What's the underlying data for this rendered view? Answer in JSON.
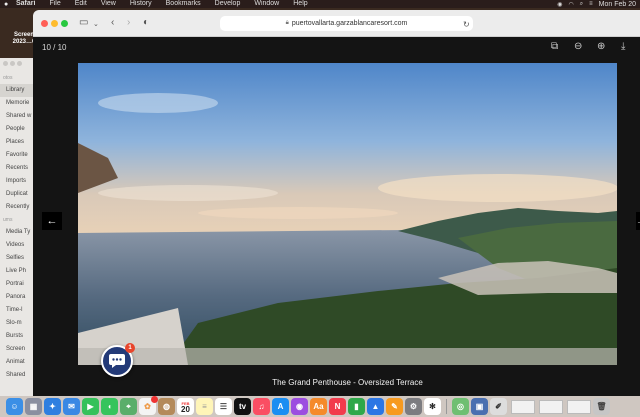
{
  "menubar": {
    "app_name": "Safari",
    "items": [
      "File",
      "Edit",
      "View",
      "History",
      "Bookmarks",
      "Develop",
      "Window",
      "Help"
    ],
    "clock": "Mon Feb 20"
  },
  "desktop": {
    "file_name_line1": "Screen",
    "file_name_line2": "2023…6"
  },
  "photos_sidebar": {
    "section_photos": "otos",
    "items_top": [
      "Library",
      "Memorie",
      "Shared w",
      "People",
      "Places",
      "Favorite",
      "Recents",
      "Imports",
      "Duplicat",
      "Recently"
    ],
    "section_albums": "ums",
    "items_bottom": [
      "Media Ty",
      "Videos",
      "Selfies",
      "Live Ph",
      "Portrai",
      "Panora",
      "Time-l",
      "Slo-m",
      "Bursts",
      "Screen",
      "Animat",
      "Shared"
    ]
  },
  "browser": {
    "url": "puertovallarta.garzablancaresort.com",
    "icons": {
      "sidebar": "sidebar-icon",
      "back": "chevron-left-icon",
      "forward": "chevron-right-icon",
      "privacy": "shield-icon",
      "lock": "lock-icon",
      "info": "info-icon",
      "reload": "reload-icon",
      "share": "share-icon",
      "new_tab": "plus-icon",
      "tabs": "tab-overview-icon"
    }
  },
  "gallery": {
    "counter": "10 / 10",
    "caption": "The Grand Penthouse - Oversized Terrace",
    "icons": {
      "fullscreen": "fullscreen-icon",
      "zoom_out": "zoom-out-icon",
      "zoom_in": "zoom-in-icon",
      "download": "download-icon",
      "prev": "arrow-left-icon",
      "next": "arrow-right-icon"
    }
  },
  "chat_widget": {
    "badge_count": "1",
    "icon": "chat-bubble-icon"
  },
  "dock": {
    "calendar_month": "FEB",
    "calendar_day": "20",
    "apps": [
      "finder",
      "launchpad",
      "safari",
      "mail",
      "facetime",
      "messages",
      "maps",
      "photos",
      "contacts",
      "calendar",
      "notes",
      "reminders",
      "tv",
      "music",
      "app-store",
      "podcasts",
      "books",
      "news",
      "numbers",
      "keynote",
      "pages",
      "system-preferences",
      "chatgpt",
      "preview",
      "terminal",
      "textedit"
    ]
  },
  "colors": {
    "accent_chat": "#233a78",
    "badge_red": "#e8452c",
    "lightbox_bg": "#141414"
  }
}
